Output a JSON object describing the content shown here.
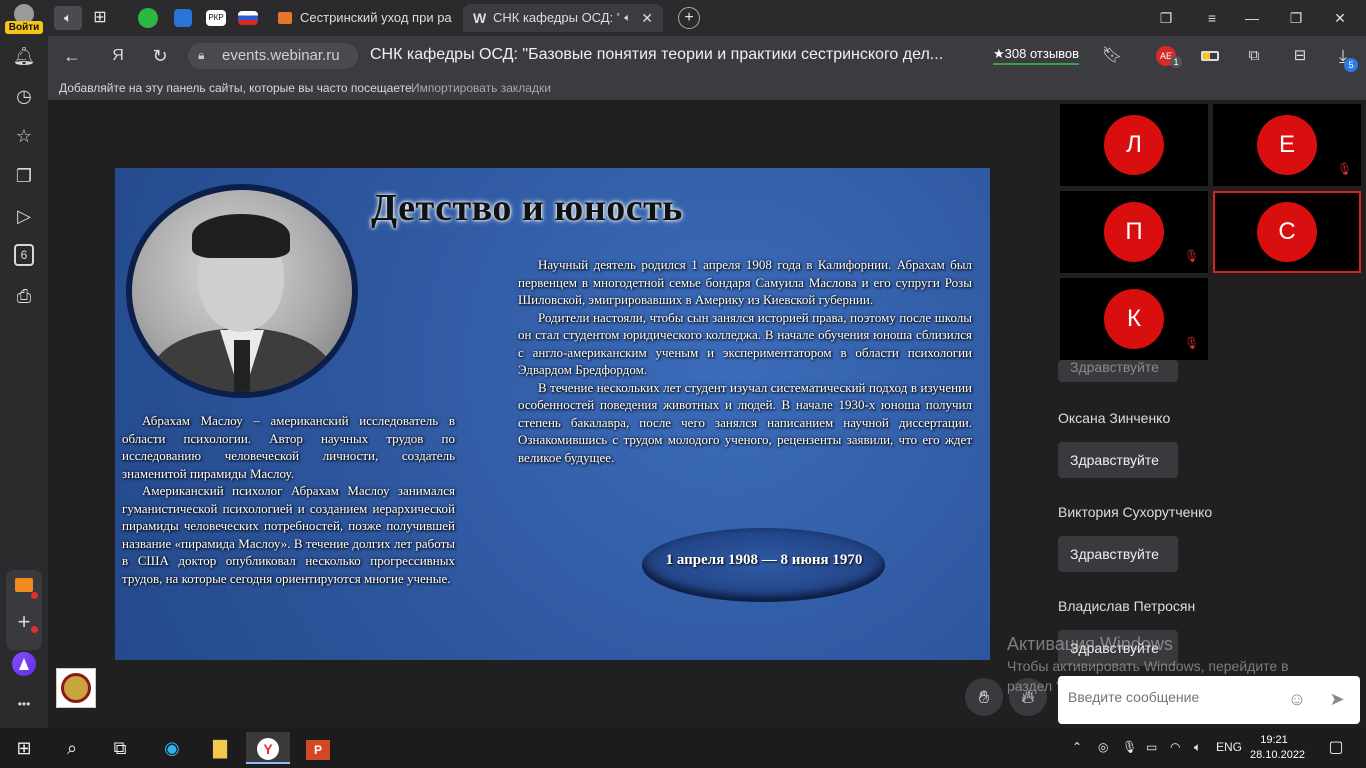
{
  "sidebar": {
    "login_label": "Войти",
    "icons": [
      "bell-icon",
      "history-icon",
      "star-icon",
      "collections-icon",
      "play-icon",
      "tabs-count-icon",
      "screenshot-icon"
    ],
    "tabs_count": "6",
    "more": "•••"
  },
  "tabbar": {
    "tabs": [
      {
        "label": "Сестринский уход при ра"
      },
      {
        "label": "СНК кафедры ОСД: \""
      }
    ],
    "pinned_badge": "РКР",
    "new_tab": "+"
  },
  "addressbar": {
    "domain": "events.webinar.ru",
    "page_title": "СНК кафедры ОСД: \"Базовые понятия теории и практики сестринского дел...",
    "reviews": "308 отзывов",
    "ext_badge": "1",
    "downloads_badge": "5"
  },
  "bookmarks_bar": {
    "message": "Добавляйте на эту панель сайты, которые вы часто посещаете.",
    "import_link": "Импортировать закладки"
  },
  "slide": {
    "title": "Детство и юность",
    "left_text": [
      "Абрахам Маслоу – американский исследователь в области психологии. Автор научных трудов по исследованию человеческой личности, создатель знаменитой пирамиды Маслоу.",
      "Американский психолог Абрахам Маслоу занимался гуманистической психологией и созданием иерархической пирамиды человеческих потребностей, позже получившей название «пирамида Маслоу». В течение долгих лет работы в США доктор опубликовал несколько прогрессивных трудов, на которые сегодня ориентируются многие ученые."
    ],
    "right_text": [
      "Научный деятель родился 1 апреля 1908 года в Калифорнии. Абрахам был первенцем в многодетной семье бондаря Самуила Маслова и его супруги Розы Шиловской, эмигрировавших в Америку из Киевской губернии.",
      "Родители настояли, чтобы сын занялся историей права, поэтому после школы он стал студентом юридического колледжа. В начале обучения юноша сблизился с англо-американским ученым и экспериментатором в области психологии Эдвардом Бредфордом.",
      "В течение нескольких лет студент изучал систематический подход в изучении особенностей поведения животных и людей. В начале 1930-х юноша получил степень бакалавра, после чего занялся написанием научной диссертации. Ознакомившись с трудом молодого ученого, рецензенты заявили, что его ждет великое будущее."
    ],
    "dates": "1 апреля 1908 — 8 июня 1970"
  },
  "participants": [
    {
      "initial": "Л",
      "muted": false,
      "speaking": false
    },
    {
      "initial": "Е",
      "muted": true,
      "speaking": false
    },
    {
      "initial": "П",
      "muted": true,
      "speaking": false
    },
    {
      "initial": "С",
      "muted": false,
      "speaking": true
    },
    {
      "initial": "К",
      "muted": true,
      "speaking": false
    }
  ],
  "chat": {
    "messages": [
      {
        "name": "",
        "text": "Здравствуйте"
      },
      {
        "name": "Оксана Зинченко",
        "text": "Здравствуйте"
      },
      {
        "name": "Виктория Сухорутченко",
        "text": "Здравствуйте"
      },
      {
        "name": "Владислав Петросян",
        "text": "Здравствуйте"
      }
    ],
    "input_placeholder": "Введите сообщение"
  },
  "watermark": {
    "title": "Активация Windows",
    "line1": "Чтобы активировать Windows, перейдите в",
    "line2": "раздел \"Параметры\"."
  },
  "taskbar": {
    "language": "ENG",
    "time": "19:21",
    "date": "28.10.2022"
  },
  "colors": {
    "accent_red": "#d90e0e",
    "slide_blue": "#2f5aa3",
    "login_yellow": "#f5c518"
  }
}
